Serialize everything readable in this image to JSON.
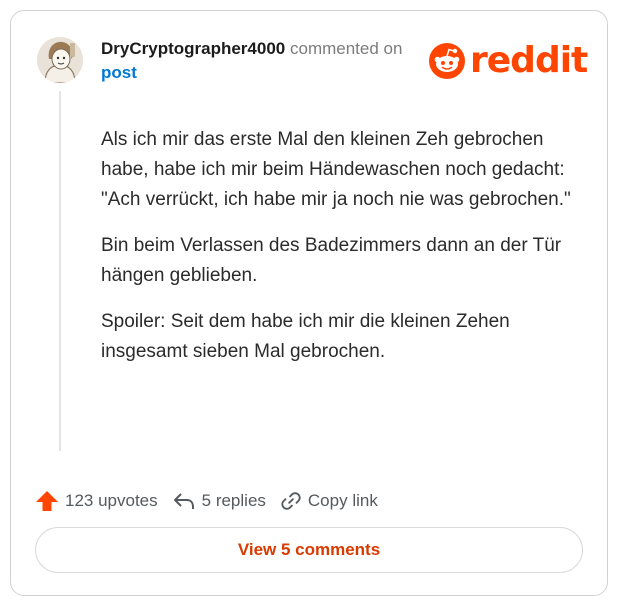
{
  "comment": {
    "username": "DryCryptographer4000",
    "action_text": "commented on",
    "target_link": "post",
    "avatar": "avatar-icon",
    "paragraphs": [
      "Als ich mir das erste Mal den kleinen Zeh gebrochen habe, habe ich mir beim Händewaschen noch gedacht: \"Ach verrückt, ich habe mir ja noch nie was gebrochen.\"",
      "Bin beim Verlassen des Badezimmers dann an der Tür hängen geblieben.",
      "Spoiler: Seit dem habe ich mir die kleinen Zehen insgesamt sieben Mal gebrochen."
    ]
  },
  "brand": {
    "name": "reddit",
    "color": "#ff4500",
    "icon": "reddit-snoo-icon"
  },
  "actions": {
    "upvotes_label": "123 upvotes",
    "replies_label": "5 replies",
    "copy_label": "Copy link",
    "upvote_icon": "upvote-arrow-icon",
    "reply_icon": "reply-arrow-icon",
    "link_icon": "link-icon"
  },
  "footer": {
    "view_comments_label": "View 5 comments",
    "accent": "#d93a00"
  }
}
